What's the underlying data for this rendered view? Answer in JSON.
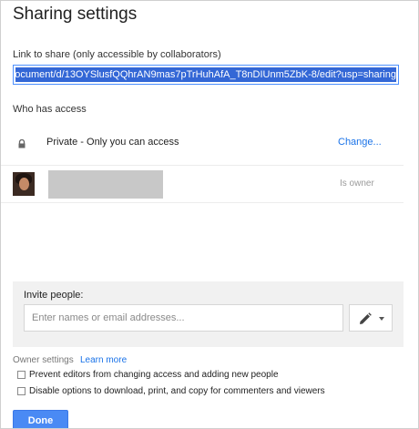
{
  "dialog": {
    "title": "Sharing settings"
  },
  "link_share": {
    "label": "Link to share (only accessible by collaborators)",
    "value": "ocument/d/13OYSlusfQQhrAN9mas7pTrHuhAfA_T8nDIUnm5ZbK-8/edit?usp=sharing"
  },
  "access": {
    "heading": "Who has access",
    "private_row": {
      "icon": "lock-icon",
      "text": "Private - Only you can access",
      "change_label": "Change..."
    },
    "owner_row": {
      "avatar": "avatar",
      "role_text": "Is owner"
    }
  },
  "invite": {
    "label": "Invite people:",
    "placeholder": "Enter names or email addresses...",
    "permission_icon": "pencil-icon"
  },
  "owner_settings": {
    "label": "Owner settings",
    "learn_more": "Learn more",
    "options": [
      {
        "label": "Prevent editors from changing access and adding new people",
        "checked": false
      },
      {
        "label": "Disable options to download, print, and copy for commenters and viewers",
        "checked": false
      }
    ]
  },
  "footer": {
    "done_label": "Done"
  },
  "colors": {
    "accent": "#4a8af4",
    "link": "#1a73e8",
    "selection": "#3367d6",
    "panel": "#f1f1f1"
  }
}
